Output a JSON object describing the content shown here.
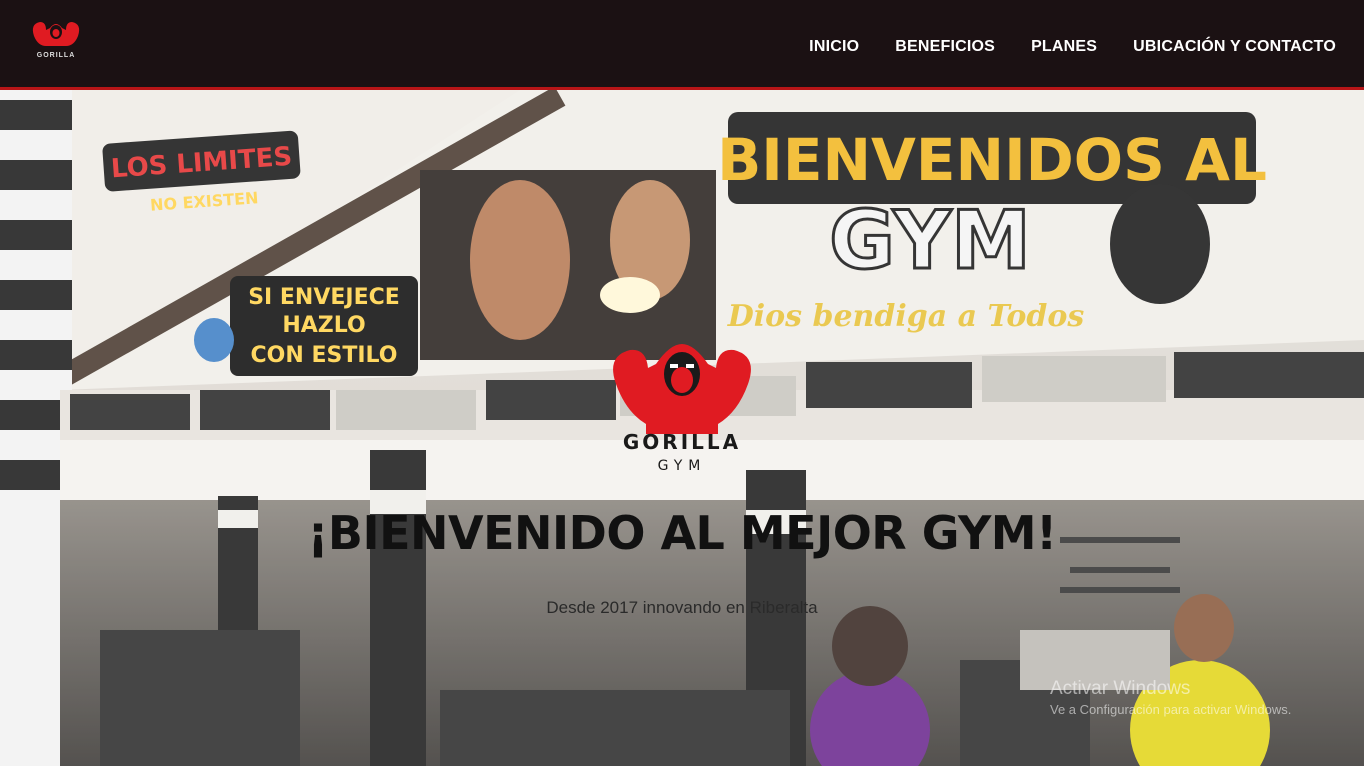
{
  "nav": {
    "logo_text": "GORILLA",
    "links": [
      "INICIO",
      "BENEFICIOS",
      "PLANES",
      "UBICACIÓN Y CONTACTO"
    ]
  },
  "hero": {
    "brand": "GORILLA",
    "brand_sub": "GYM",
    "title": "¡BIENVENIDO AL MEJOR GYM!",
    "subtitle": "Desde 2017 innovando en Riberalta"
  },
  "wall_signs": {
    "left_top_1": "LOS LIMITES",
    "left_top_2": "NO EXISTEN",
    "left_mid_1": "SI ENVEJECE",
    "left_mid_2": "HAZLO",
    "left_mid_3": "CON ESTILO",
    "right_1": "BIENVENIDOS AL",
    "right_2": "GYM",
    "right_3": "Dios bendiga a Todos"
  },
  "watermark": {
    "title": "Activar Windows",
    "subtitle": "Ve a Configuración para activar Windows."
  },
  "colors": {
    "accent": "#b81517",
    "nav_bg": "#1b1113",
    "logo_red": "#e01b22"
  }
}
